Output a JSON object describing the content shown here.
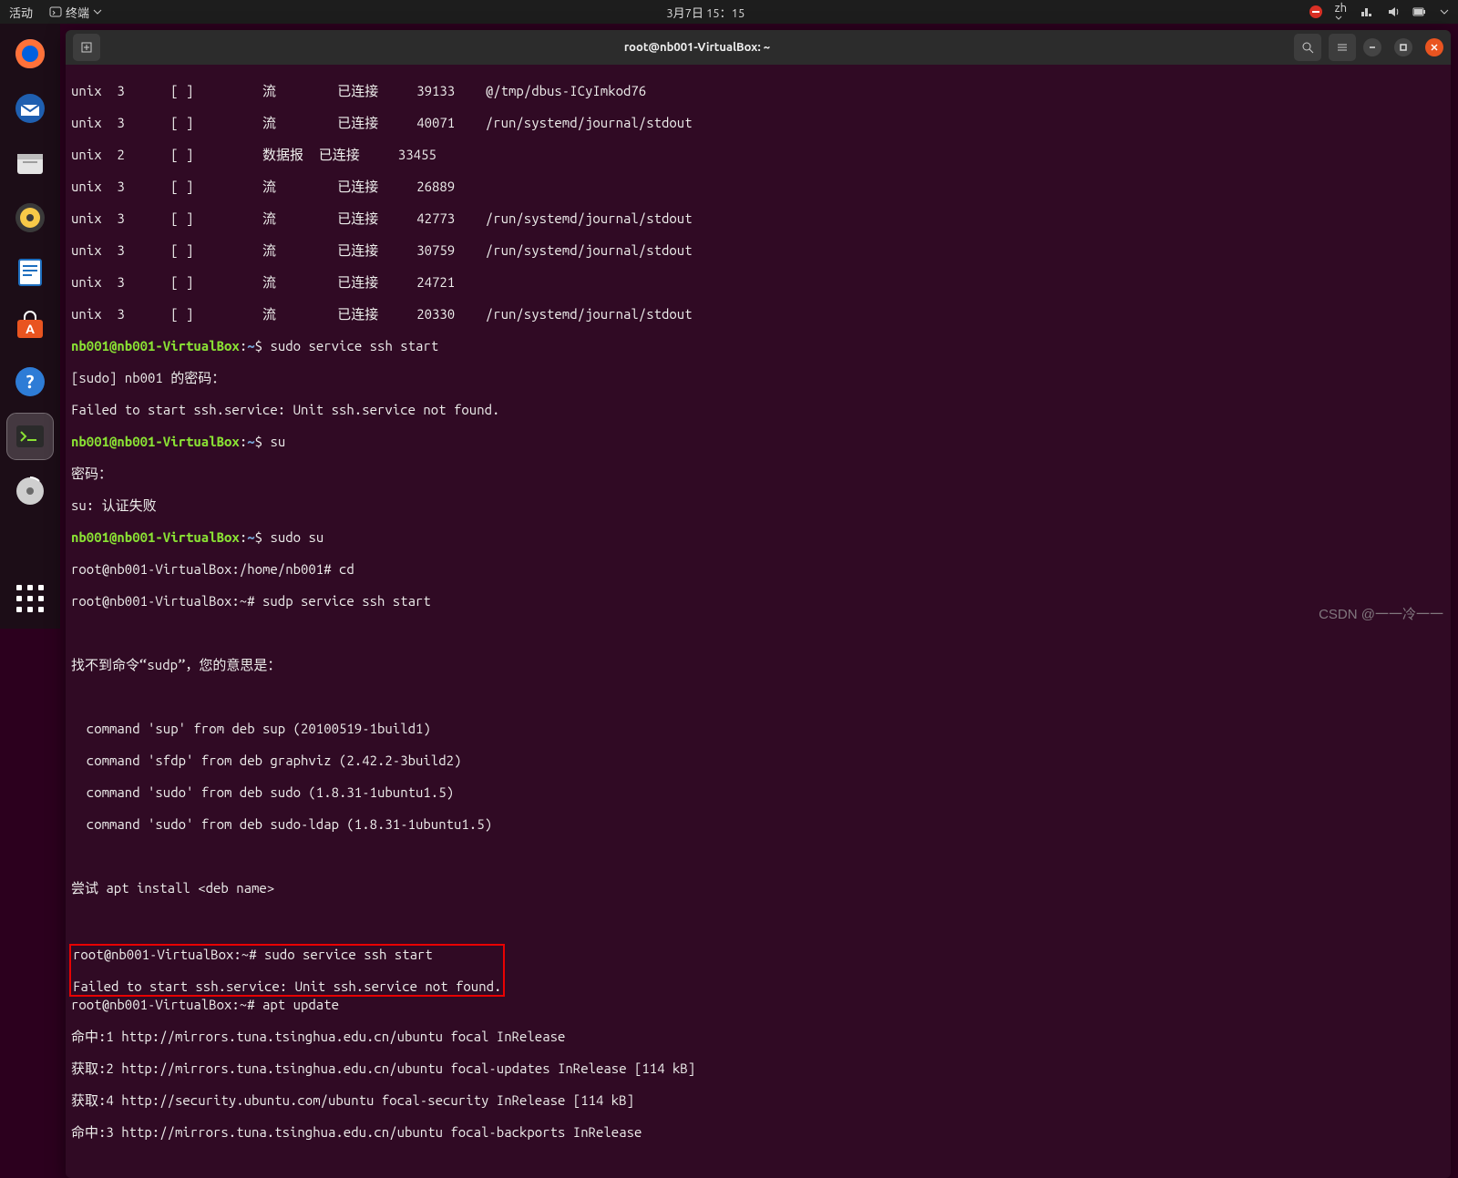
{
  "topbar": {
    "activities": "活动",
    "app_menu": "终端",
    "clock": "3月7日 15：15",
    "lang": "zh"
  },
  "dock": {
    "items": [
      {
        "name": "firefox"
      },
      {
        "name": "thunderbird"
      },
      {
        "name": "files"
      },
      {
        "name": "rhythmbox"
      },
      {
        "name": "libreoffice-writer"
      },
      {
        "name": "ubuntu-software"
      },
      {
        "name": "help"
      },
      {
        "name": "terminal"
      },
      {
        "name": "disk"
      }
    ]
  },
  "window": {
    "title": "root@nb001-VirtualBox: ~"
  },
  "prompt": {
    "user": "nb001@nb001-VirtualBox",
    "root": "root@nb001-VirtualBox",
    "home": "~",
    "rootpath": "/home/nb001"
  },
  "term": {
    "netstat": [
      "unix  3      [ ]         流        已连接     39133    @/tmp/dbus-ICyImkod76",
      "unix  3      [ ]         流        已连接     40071    /run/systemd/journal/stdout",
      "unix  2      [ ]         数据报  已连接     33455    ",
      "unix  3      [ ]         流        已连接     26889    ",
      "unix  3      [ ]         流        已连接     42773    /run/systemd/journal/stdout",
      "unix  3      [ ]         流        已连接     30759    /run/systemd/journal/stdout",
      "unix  3      [ ]         流        已连接     24721    ",
      "unix  3      [ ]         流        已连接     20330    /run/systemd/journal/stdout"
    ],
    "cmd_ssh1": "sudo service ssh start",
    "sudo_pw": "[sudo] nb001 的密码：",
    "fail_ssh": "Failed to start ssh.service: Unit ssh.service not found.",
    "cmd_su": "su",
    "pw": "密码：",
    "su_fail": "su: 认证失败",
    "cmd_sudosu": "sudo su",
    "root_cd_line": "root@nb001-VirtualBox:/home/nb001# cd",
    "root_sudp_line": "root@nb001-VirtualBox:~# sudp service ssh start",
    "sudp_err_head": "找不到命令“sudp”，您的意思是：",
    "sudp_suggestions": [
      "  command 'sup' from deb sup (20100519-1build1)",
      "  command 'sfdp' from deb graphviz (2.42.2-3build2)",
      "  command 'sudo' from deb sudo (1.8.31-1ubuntu1.5)",
      "  command 'sudo' from deb sudo-ldap (1.8.31-1ubuntu1.5)"
    ],
    "sudp_try": "尝试 apt install <deb name>",
    "hl_line1": "root@nb001-VirtualBox:~# sudo service ssh start",
    "hl_line2": "Failed to start ssh.service: Unit ssh.service not found.",
    "apt_update_line": "root@nb001-VirtualBox:~# apt update",
    "apt_lines": [
      "命中:1 http://mirrors.tuna.tsinghua.edu.cn/ubuntu focal InRelease",
      "获取:2 http://mirrors.tuna.tsinghua.edu.cn/ubuntu focal-updates InRelease [114 kB]",
      "获取:4 http://security.ubuntu.com/ubuntu focal-security InRelease [114 kB]",
      "命中:3 http://mirrors.tuna.tsinghua.edu.cn/ubuntu focal-backports InRelease"
    ]
  },
  "watermark": "CSDN @一一冷一一"
}
